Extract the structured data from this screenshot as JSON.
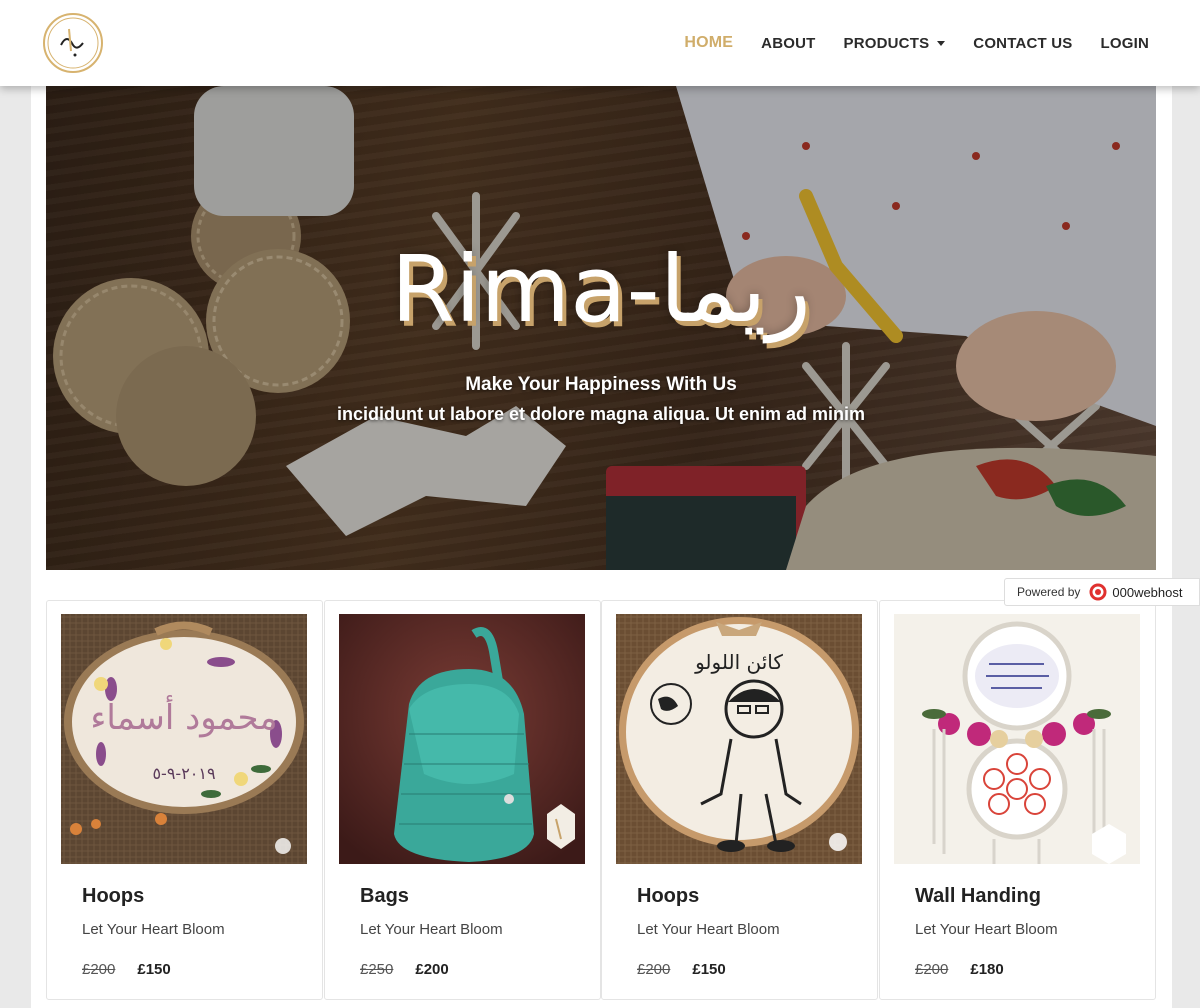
{
  "brand": {
    "logo_alt": "Rima logo"
  },
  "nav": {
    "items": [
      {
        "label": "HOME",
        "active": true
      },
      {
        "label": "ABOUT"
      },
      {
        "label": "PRODUCTS",
        "dropdown": true
      },
      {
        "label": "CONTACT US"
      },
      {
        "label": "LOGIN"
      }
    ]
  },
  "hero": {
    "title": "Rima-ريما",
    "subtitle": "Make Your Happiness With Us",
    "tagline": "incididunt ut labore et dolore magna aliqua. Ut enim ad minim"
  },
  "powered": {
    "prefix": "Powered by",
    "brand": "000webhost"
  },
  "products": [
    {
      "title": "Hoops",
      "text": "Let Your Heart Bloom",
      "old_price": "£200",
      "new_price": "£150",
      "image": "embroidery-hoop-names"
    },
    {
      "title": "Bags",
      "text": "Let Your Heart Bloom",
      "old_price": "£250",
      "new_price": "£200",
      "image": "teal-knit-backpack"
    },
    {
      "title": "Hoops",
      "text": "Let Your Heart Bloom",
      "old_price": "£200",
      "new_price": "£150",
      "image": "embroidery-hoop-portrait"
    },
    {
      "title": "Wall Handing",
      "text": "Let Your Heart Bloom",
      "old_price": "£200",
      "new_price": "£180",
      "image": "dreamcatcher-wall-hanging"
    }
  ],
  "colors": {
    "accent": "#d0ad6a",
    "nav_text": "#2b2b2b",
    "teal": "#3aa89a"
  }
}
